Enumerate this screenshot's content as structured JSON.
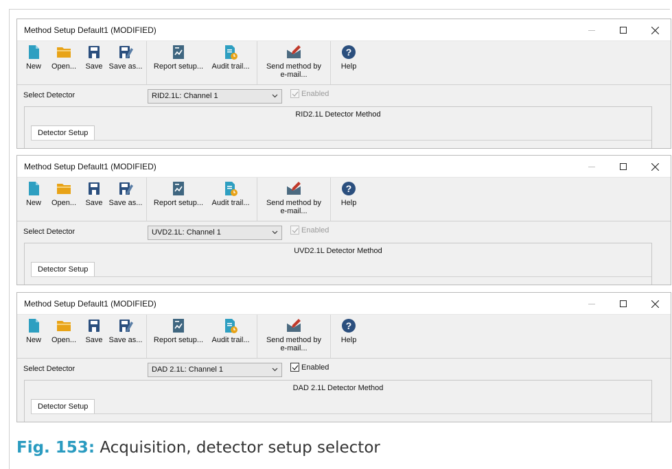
{
  "windows": [
    {
      "title": "Method Setup Default1 (MODIFIED)",
      "select_label": "Select Detector",
      "detector_value": "RID2.1L: Channel 1",
      "enabled_label": "Enabled",
      "enabled_checked": true,
      "enabled_active": false,
      "method_title": "RID2.1L Detector Method",
      "tab_label": "Detector Setup"
    },
    {
      "title": "Method Setup Default1 (MODIFIED)",
      "select_label": "Select Detector",
      "detector_value": "UVD2.1L: Channel 1",
      "enabled_label": "Enabled",
      "enabled_checked": true,
      "enabled_active": false,
      "method_title": "UVD2.1L Detector Method",
      "tab_label": "Detector Setup"
    },
    {
      "title": "Method Setup Default1 (MODIFIED)",
      "select_label": "Select Detector",
      "detector_value": "DAD 2.1L: Channel 1",
      "enabled_label": "Enabled",
      "enabled_checked": true,
      "enabled_active": true,
      "method_title": "DAD 2.1L Detector Method",
      "tab_label": "Detector Setup"
    }
  ],
  "toolbar": {
    "new": "New",
    "open": "Open...",
    "save": "Save",
    "save_as": "Save as...",
    "report_setup": "Report setup...",
    "audit_trail": "Audit trail...",
    "send_method_line1": "Send method by",
    "send_method_line2": "e-mail...",
    "help": "Help"
  },
  "icons": {
    "new": "new-document-icon",
    "open": "folder-icon",
    "save": "floppy-disk-icon",
    "save_as": "save-as-icon",
    "report_setup": "report-icon",
    "audit_trail": "audit-trail-icon",
    "send_method": "send-email-icon",
    "help": "help-icon"
  },
  "colors": {
    "icon_teal": "#2e9fc1",
    "icon_folder": "#e8a317",
    "icon_navy": "#2b4f7e",
    "icon_gray": "#4c6a80",
    "caption_accent": "#2a9bc0"
  },
  "caption": {
    "figure": "Fig. 153:",
    "text": "Acquisition, detector setup selector"
  }
}
